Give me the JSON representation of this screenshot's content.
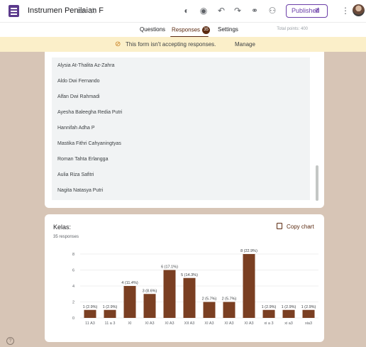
{
  "header": {
    "title": "Instrumen Penilaian F",
    "publish_label": "Published"
  },
  "tabs": [
    {
      "label": "Questions"
    },
    {
      "label": "Responses",
      "badge": "35"
    },
    {
      "label": "Settings"
    }
  ],
  "total_points": "Total points: 400",
  "banner": {
    "message": "This form isn't accepting responses.",
    "action": "Manage"
  },
  "names": [
    "Alysia At-Thalita Az-Zahra",
    "Aldo Dwi Fernando",
    "Alfan Dwi Rahmadi",
    "Ayesha Baleegha Redia Putri",
    "Hannifah Adha P",
    "Mastika Fithri Cahyaningtyas",
    "Roman Tahta Erlangga",
    "Aulia Riza Safitri",
    "Nagita Natasya Putri"
  ],
  "question": {
    "title": "Kelas:",
    "count": "35 responses",
    "copy_label": "Copy chart"
  },
  "colors": {
    "accent": "#5b2a10",
    "bar": "#7a3f22",
    "banner": "#fbefc9",
    "background": "#d7c5b6"
  },
  "chart_data": {
    "type": "bar",
    "categories": [
      "11 A3",
      "11 a 3",
      "XI",
      "XI A3",
      "XI A3",
      "XII A3",
      "XI A3",
      "XI A3",
      "XI A3",
      "xi a 3",
      "xi a3",
      "xia3"
    ],
    "values": [
      1,
      1,
      4,
      3,
      6,
      5,
      2,
      2,
      8,
      1,
      1,
      1
    ],
    "data_labels": [
      "1 (2.9%)",
      "1 (2.9%)",
      "4 (11.4%)",
      "3 (8.6%)",
      "6 (17.1%)",
      "5 (14.3%)",
      "2 (5.7%)",
      "2 (5.7%)",
      "8 (22.9%)",
      "1 (2.9%)",
      "1 (2.9%)",
      "1 (2.9%)"
    ],
    "y_ticks": [
      0,
      2,
      4,
      6,
      8
    ],
    "ylim": [
      0,
      8
    ],
    "grid": true
  }
}
